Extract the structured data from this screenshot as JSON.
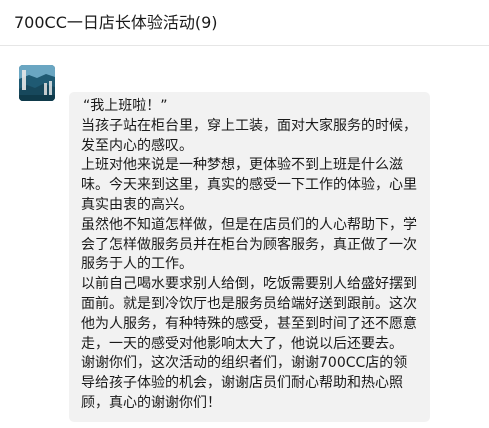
{
  "header": {
    "title": "700CC一日店长体验活动(9)"
  },
  "message": {
    "paragraphs": [
      "“我上班啦！”",
      "当孩子站在柜台里，穿上工装，面对大家服务的时候，发至内心的感叹。",
      "上班对他来说是一种梦想，更体验不到上班是什么滋味。今天来到这里，真实的感受一下工作的体验，心里真实由衷的高兴。",
      "虽然他不知道怎样做，但是在店员们的人心帮助下，学会了怎样做服务员并在柜台为顾客服务，真正做了一次服务于人的工作。",
      "以前自己喝水要求别人给倒，吃饭需要别人给盛好摆到面前。就是到冷饮厅也是服务员给端好送到跟前。这次他为人服务，有种特殊的感受，甚至到时间了还不愿意走，一天的感受对他影响太大了，他说以后还要去。",
      "谢谢你们，这次活动的组织者们，谢谢700CC店的领导给孩子体验的机会，谢谢店员们耐心帮助和热心照顾，真心的谢谢你们！"
    ]
  },
  "colors": {
    "bubble": "#f2f2f2",
    "text": "#1a1a1a",
    "divider": "#e6e6e6"
  }
}
